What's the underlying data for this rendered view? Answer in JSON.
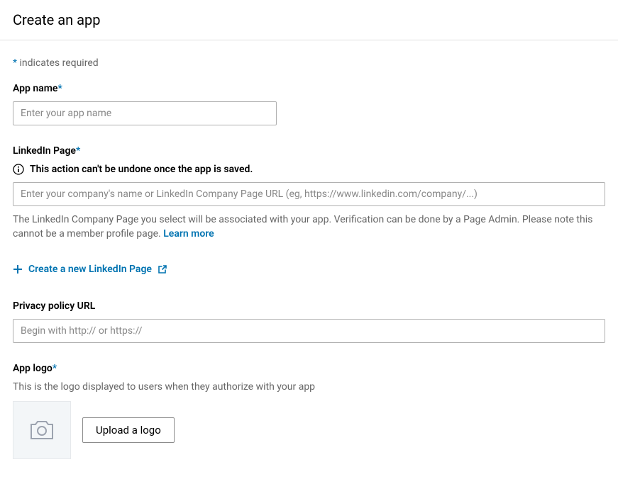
{
  "header": {
    "title": "Create an app"
  },
  "requiredNote": {
    "asterisk": "*",
    "text": " indicates required"
  },
  "appName": {
    "label": "App name",
    "asterisk": "*",
    "placeholder": "Enter your app name"
  },
  "linkedinPage": {
    "label": "LinkedIn Page",
    "asterisk": "*",
    "warning": "This action can't be undone once the app is saved.",
    "placeholder": "Enter your company's name or LinkedIn Company Page URL (eg, https://www.linkedin.com/company/...)",
    "helperText": "The LinkedIn Company Page you select will be associated with your app. Verification can be done by a Page Admin. Please note this cannot be a member profile page. ",
    "learnMore": "Learn more",
    "createLink": "Create a new LinkedIn Page"
  },
  "privacyPolicy": {
    "label": "Privacy policy URL",
    "placeholder": "Begin with http:// or https://"
  },
  "appLogo": {
    "label": "App logo",
    "asterisk": "*",
    "subText": "This is the logo displayed to users when they authorize with your app",
    "uploadButton": "Upload a logo"
  }
}
